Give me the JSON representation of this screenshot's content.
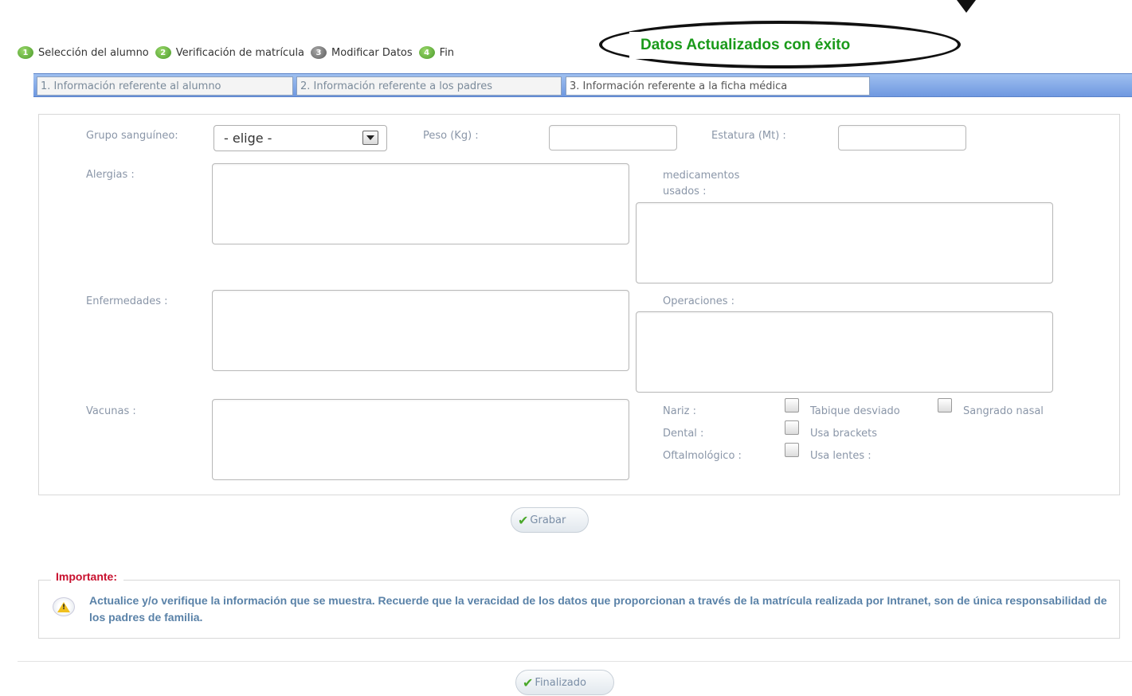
{
  "steps": [
    {
      "num": "1",
      "label": "Selección del alumno"
    },
    {
      "num": "2",
      "label": "Verificación de matrícula"
    },
    {
      "num": "3",
      "label": "Modificar Datos"
    },
    {
      "num": "4",
      "label": "Fin"
    }
  ],
  "callout": {
    "message": "Datos Actualizados con éxito"
  },
  "tabs": [
    {
      "label": "1. Información referente al alumno"
    },
    {
      "label": "2. Información referente a los padres"
    },
    {
      "label": "3. Información referente a la ficha médica"
    }
  ],
  "form": {
    "grupo_label": "Grupo sanguíneo:",
    "grupo_value": "- elige -",
    "peso_label": "Peso (Kg) :",
    "peso_value": "",
    "estatura_label": "Estatura (Mt) :",
    "estatura_value": "",
    "alergias_label": "Alergias :",
    "medicamentos_label": "medicamentos usados :",
    "enfermedades_label": "Enfermedades :",
    "operaciones_label": "Operaciones :",
    "vacunas_label": "Vacunas :",
    "nariz_label": "Nariz :",
    "tabique_label": "Tabique desviado",
    "sangrado_label": "Sangrado nasal",
    "dental_label": "Dental :",
    "brackets_label": "Usa brackets",
    "oftalmo_label": "Oftalmológico :",
    "lentes_label": "Usa lentes :"
  },
  "buttons": {
    "grabar": "Grabar",
    "finalizado": "Finalizado"
  },
  "important": {
    "title": "Importante:",
    "text": "Actualice y/o verifique la información que se muestra. Recuerde que la veracidad de los datos que proporcionan a través de la matrícula realizada por Intranet, son de única responsabilidad de los padres de familia."
  },
  "colors": {
    "accent": "#6f98e0",
    "success": "#1a9a1a",
    "important": "#c8102e",
    "info_text": "#5a82a8"
  }
}
